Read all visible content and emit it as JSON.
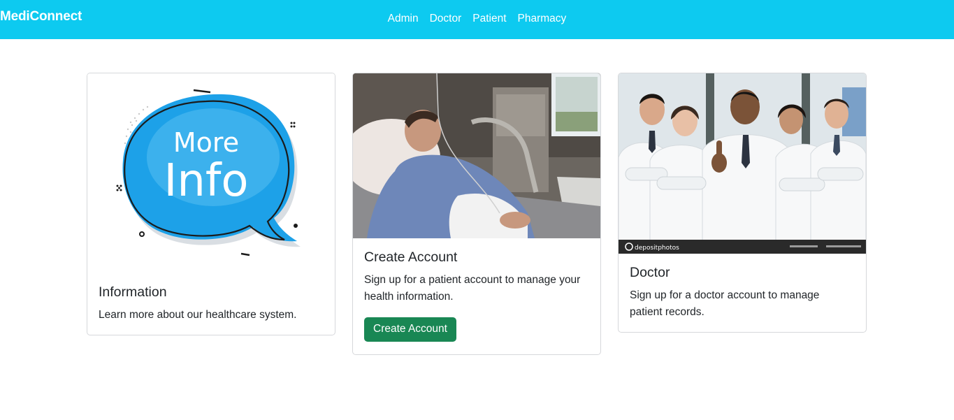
{
  "navbar": {
    "brand": "MediConnect",
    "links": [
      "Admin",
      "Doctor",
      "Patient",
      "Pharmacy"
    ],
    "color": "#0dcaf0"
  },
  "cards": [
    {
      "image_text": "More Info",
      "title": "Information",
      "text": "Learn more about our healthcare system."
    },
    {
      "title": "Create Account",
      "text": "Sign up for a patient account to manage your health information.",
      "button": "Create Account"
    },
    {
      "image_watermark": "depositphotos",
      "title": "Doctor",
      "text": "Sign up for a doctor account to manage patient records."
    }
  ],
  "colors": {
    "button": "#198754",
    "speech_bubble": "#1da1e8"
  }
}
